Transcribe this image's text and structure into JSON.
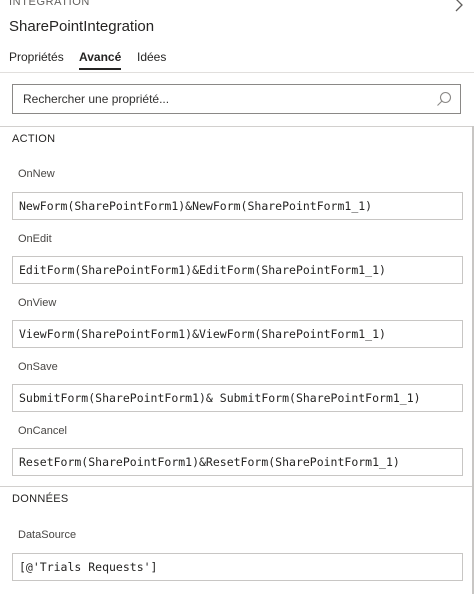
{
  "panel": {
    "category": "INTEGRATION",
    "title": "SharePointIntegration"
  },
  "tabs": [
    {
      "label": "Propriétés",
      "active": false
    },
    {
      "label": "Avancé",
      "active": true
    },
    {
      "label": "Idées",
      "active": false
    }
  ],
  "search": {
    "placeholder": "Rechercher une propriété..."
  },
  "sections": [
    {
      "title": "ACTION",
      "properties": [
        {
          "label": "OnNew",
          "value": "NewForm(SharePointForm1)&NewForm(SharePointForm1_1)"
        },
        {
          "label": "OnEdit",
          "value": "EditForm(SharePointForm1)&EditForm(SharePointForm1_1)"
        },
        {
          "label": "OnView",
          "value": "ViewForm(SharePointForm1)&ViewForm(SharePointForm1_1)"
        },
        {
          "label": "OnSave",
          "value": "SubmitForm(SharePointForm1)& SubmitForm(SharePointForm1_1)"
        },
        {
          "label": "OnCancel",
          "value": "ResetForm(SharePointForm1)&ResetForm(SharePointForm1_1)"
        }
      ]
    },
    {
      "title": "DONNÉES",
      "properties": [
        {
          "label": "DataSource",
          "value": "[@'Trials Requests']"
        }
      ]
    }
  ],
  "icons": {
    "search": "search-icon",
    "chevron": "chevron-right-icon"
  }
}
